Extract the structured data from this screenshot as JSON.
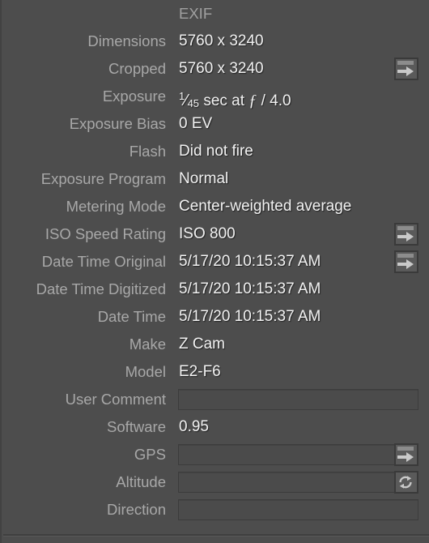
{
  "panel": {
    "section_header": "EXIF",
    "colors": {
      "background": "#4d4d4d",
      "label_text": "#a8a8a8",
      "value_text": "#f2f2f2",
      "field_border": "#3c3c3c",
      "button_face": "#5a5a5a",
      "button_border": "#3a3a3a"
    }
  },
  "rows": [
    {
      "label": "Dimensions",
      "value": "5760 x 3240"
    },
    {
      "label": "Cropped",
      "value": "5760 x 3240",
      "button": "arrow-right"
    },
    {
      "label": "Exposure",
      "value": "1/45 sec at f / 4.0",
      "numerator": "1",
      "denominator": "45",
      "suffix": "sec at",
      "fstop": "/ 4.0"
    },
    {
      "label": "Exposure Bias",
      "value": "0 EV"
    },
    {
      "label": "Flash",
      "value": "Did not fire"
    },
    {
      "label": "Exposure Program",
      "value": "Normal"
    },
    {
      "label": "Metering Mode",
      "value": "Center-weighted average"
    },
    {
      "label": "ISO Speed Rating",
      "value": "ISO 800",
      "button": "arrow-right"
    },
    {
      "label": "Date Time Original",
      "value": "5/17/20 10:15:37 AM",
      "button": "arrow-right"
    },
    {
      "label": "Date Time Digitized",
      "value": "5/17/20 10:15:37 AM"
    },
    {
      "label": "Date Time",
      "value": "5/17/20 10:15:37 AM"
    },
    {
      "label": "Make",
      "value": "Z Cam"
    },
    {
      "label": "Model",
      "value": "E2-F6"
    },
    {
      "label": "User Comment",
      "value": "",
      "field": "wide"
    },
    {
      "label": "Software",
      "value": "0.95"
    },
    {
      "label": "GPS",
      "value": "",
      "field": "short",
      "button": "arrow-right"
    },
    {
      "label": "Altitude",
      "value": "",
      "field": "short",
      "button": "refresh"
    },
    {
      "label": "Direction",
      "value": "",
      "field": "wide"
    }
  ]
}
